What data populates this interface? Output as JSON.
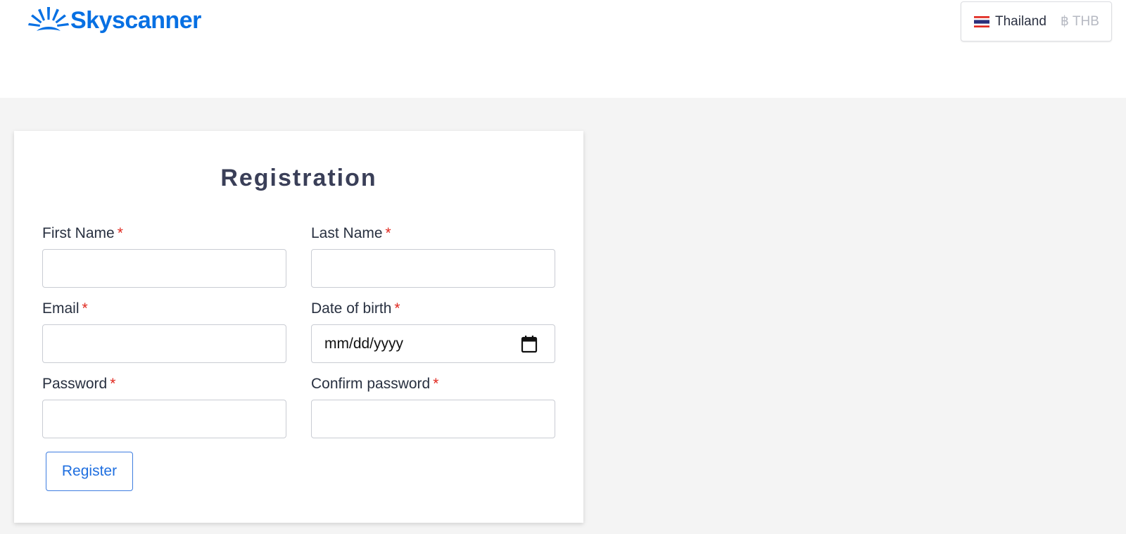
{
  "brand": {
    "name": "Skyscanner",
    "color": "#0770e3"
  },
  "header": {
    "locale": {
      "country": "Thailand",
      "currency": "฿ THB",
      "flag_icon": "thailand-flag-icon"
    }
  },
  "form": {
    "title": "Registration",
    "required_mark": "*",
    "fields": {
      "first_name": {
        "label": "First Name",
        "value": ""
      },
      "last_name": {
        "label": "Last Name",
        "value": ""
      },
      "email": {
        "label": "Email",
        "value": ""
      },
      "dob": {
        "label": "Date of birth",
        "placeholder": "mm/dd/yyyy",
        "icon": "calendar-icon"
      },
      "password": {
        "label": "Password",
        "value": ""
      },
      "confirm_password": {
        "label": "Confirm password",
        "value": ""
      }
    },
    "submit_label": "Register"
  },
  "colors": {
    "page_background": "#f4f4f4",
    "required_asterisk": "#e0281f",
    "button_accent": "#1f6fe0"
  }
}
